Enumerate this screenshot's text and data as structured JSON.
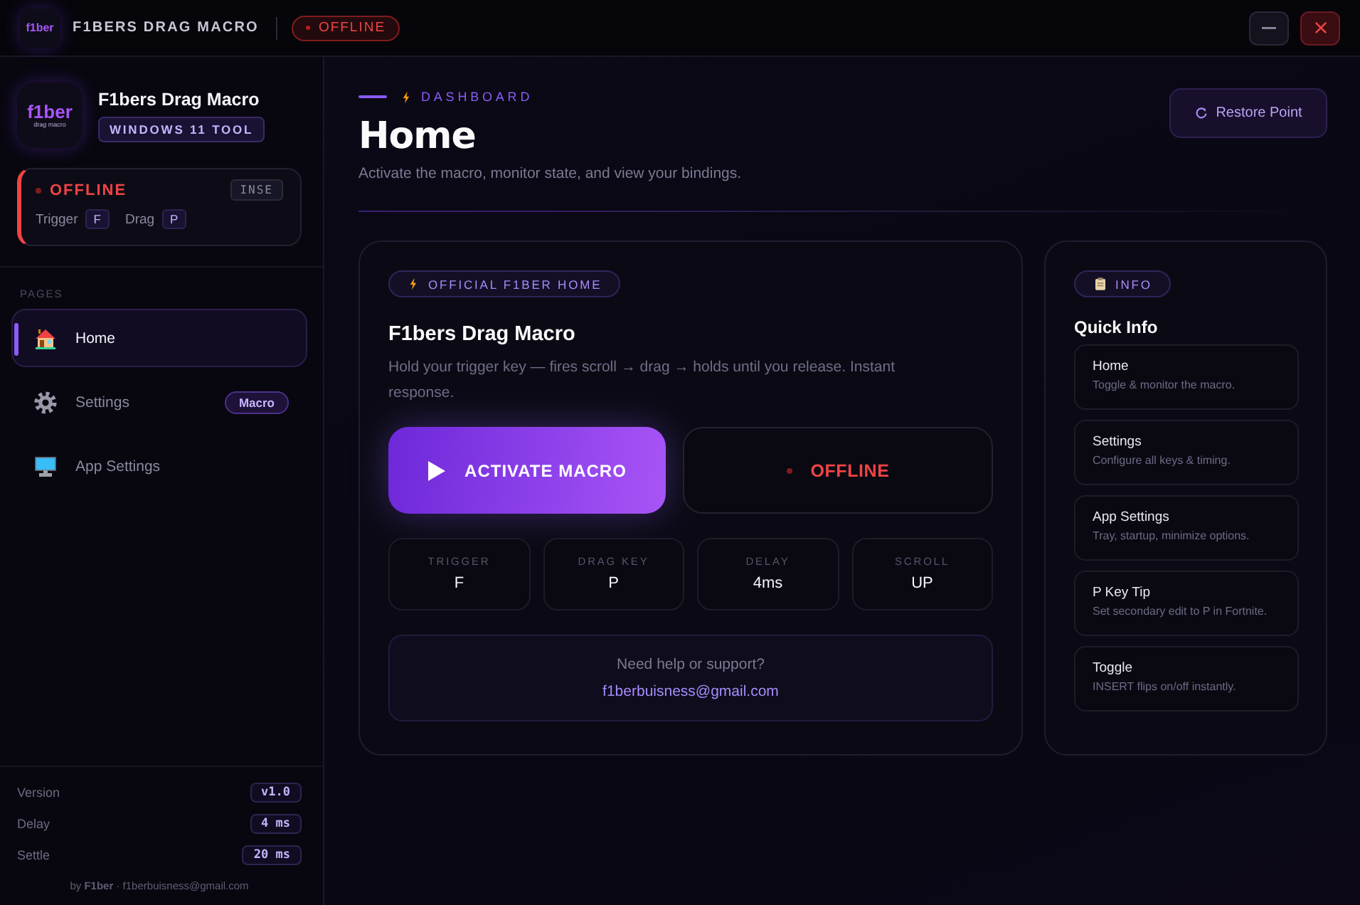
{
  "titlebar": {
    "logo": {
      "wordmark": "f1ber"
    },
    "title": "F1BERS DRAG MACRO",
    "status": {
      "label": "OFFLINE",
      "active": false
    }
  },
  "sidebar": {
    "logo": {
      "wordmark": "f1ber",
      "tagline": "drag macro"
    },
    "app_name": "F1bers Drag Macro",
    "badge": "WINDOWS 11 TOOL",
    "status_card": {
      "label": "OFFLINE",
      "active": false,
      "hotkey": "INSE",
      "bindings": [
        {
          "label": "Trigger",
          "key": "F"
        },
        {
          "label": "Drag",
          "key": "P"
        }
      ]
    },
    "section_label": "PAGES",
    "items": [
      {
        "label": "Home",
        "selected": true
      },
      {
        "label": "Settings",
        "selected": false,
        "badge": "Macro"
      },
      {
        "label": "App Settings",
        "selected": false
      }
    ],
    "meta": [
      {
        "label": "Version",
        "value": "v1.0"
      },
      {
        "label": "Delay",
        "value": "4 ms"
      },
      {
        "label": "Settle",
        "value": "20 ms"
      }
    ],
    "footer": "by **F1ber** · f1berbuisness@gmail.com"
  },
  "header": {
    "eyebrow": "DASHBOARD",
    "title": "Home",
    "subtitle": "Activate the macro, monitor state, and view your bindings.",
    "restore_button": "Restore Point"
  },
  "main_card": {
    "badge": "OFFICIAL F1BER HOME",
    "title": "F1bers Drag Macro",
    "description": "Hold your trigger key — fires scroll → drag → holds until you release. Instant response.",
    "activate_button": "ACTIVATE MACRO",
    "status": {
      "label": "OFFLINE",
      "active": false
    },
    "stats": [
      {
        "label": "TRIGGER",
        "value": "F"
      },
      {
        "label": "DRAG KEY",
        "value": "P"
      },
      {
        "label": "DELAY",
        "value": "4ms"
      },
      {
        "label": "SCROLL",
        "value": "UP"
      }
    ],
    "support": {
      "prompt": "Need help or support?",
      "email": "f1berbuisness@gmail.com"
    }
  },
  "info_panel": {
    "badge": "INFO",
    "title": "Quick Info",
    "items": [
      {
        "title": "Home",
        "description": "Toggle & monitor the macro."
      },
      {
        "title": "Settings",
        "description": "Configure all keys & timing."
      },
      {
        "title": "App Settings",
        "description": "Tray, startup, minimize options."
      },
      {
        "title": "P Key Tip",
        "description": "Set secondary edit to P in Fortnite."
      },
      {
        "title": "Toggle",
        "description": "INSERT flips on/off instantly."
      }
    ]
  }
}
